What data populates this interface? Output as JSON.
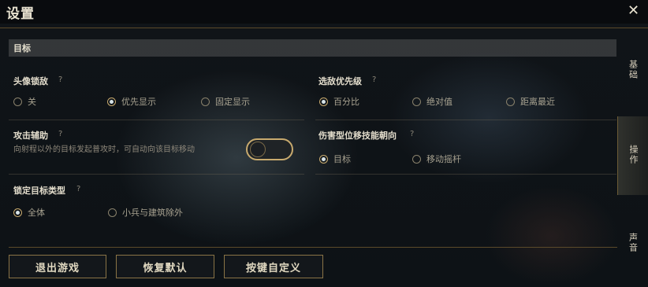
{
  "window": {
    "title": "设置",
    "close_icon": "close-icon"
  },
  "side_tabs": [
    {
      "label": "基础",
      "active": false
    },
    {
      "label": "操作",
      "active": true
    },
    {
      "label": "声音",
      "active": false
    }
  ],
  "section": {
    "title": "目标"
  },
  "champion_lock": {
    "label": "头像锁敌",
    "help": "?",
    "options": [
      {
        "label": "关",
        "selected": false
      },
      {
        "label": "优先显示",
        "selected": true
      },
      {
        "label": "固定显示",
        "selected": false
      }
    ]
  },
  "target_priority": {
    "label": "选敌优先级",
    "help": "?",
    "options": [
      {
        "label": "百分比",
        "selected": true
      },
      {
        "label": "绝对值",
        "selected": false
      },
      {
        "label": "距离最近",
        "selected": false
      }
    ]
  },
  "attack_assist": {
    "label": "攻击辅助",
    "help": "?",
    "description": "向射程以外的目标发起普攻时，可自动向该目标移动",
    "enabled": false
  },
  "damage_skill_direction": {
    "label": "伤害型位移技能朝向",
    "help": "?",
    "options": [
      {
        "label": "目标",
        "selected": true
      },
      {
        "label": "移动摇杆",
        "selected": false
      }
    ]
  },
  "lock_target_type": {
    "label": "锁定目标类型",
    "help": "?",
    "options": [
      {
        "label": "全体",
        "selected": true
      },
      {
        "label": "小兵与建筑除外",
        "selected": false
      }
    ]
  },
  "buttons": {
    "exit": "退出游戏",
    "restore": "恢复默认",
    "keybind": "按键自定义"
  },
  "colors": {
    "accent_gold": "#c8aa6e",
    "background": "#101418"
  }
}
